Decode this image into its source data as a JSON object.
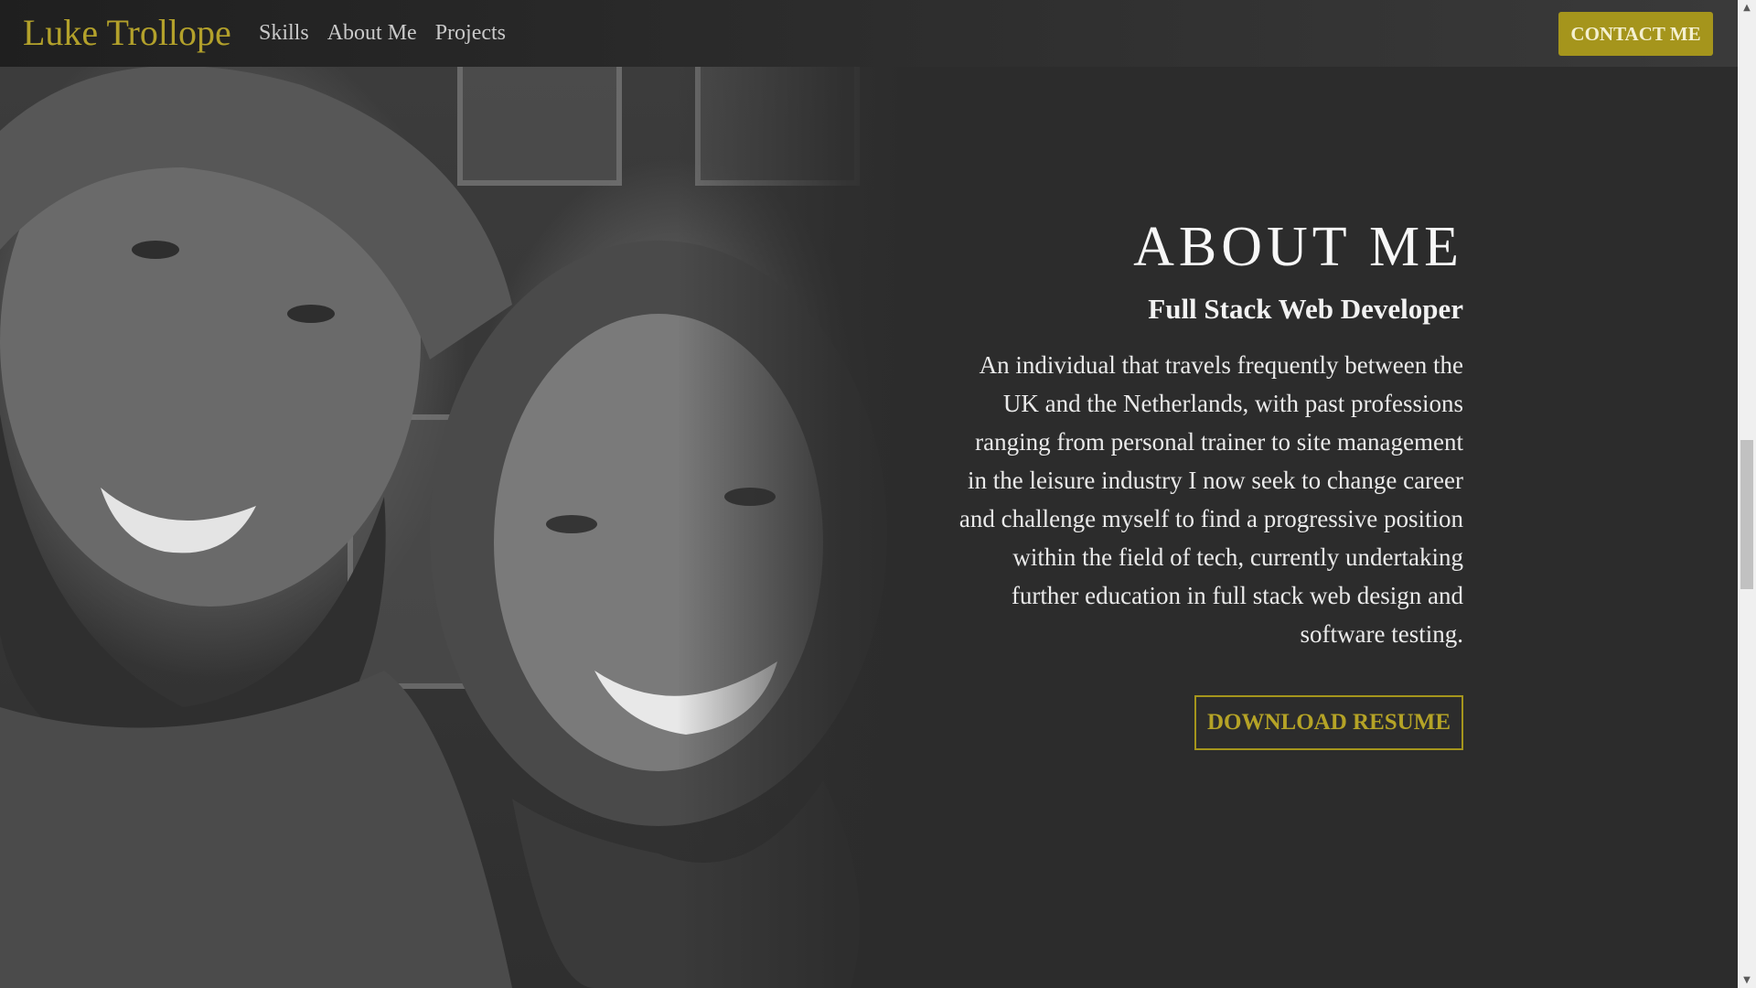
{
  "nav": {
    "brand": "Luke Trollope",
    "links": [
      "Skills",
      "About Me",
      "Projects"
    ],
    "contact_label": "CONTACT ME"
  },
  "about": {
    "title": "ABOUT ME",
    "subtitle": "Full Stack Web Developer",
    "body": "An individual that travels frequently between the UK and the Netherlands, with past professions ranging from personal trainer to site management in the leisure industry I now seek to change career and challenge myself to find a progressive position within the field of tech, currently undertaking further education in full stack web design and software testing.",
    "download_label": "DOWNLOAD RESUME"
  },
  "scrollbar": {
    "up_icon": "▲",
    "down_icon": "▼"
  },
  "colors": {
    "accent": "#a5951c",
    "background": "#2c2c2c",
    "text": "#f2f2f2"
  }
}
